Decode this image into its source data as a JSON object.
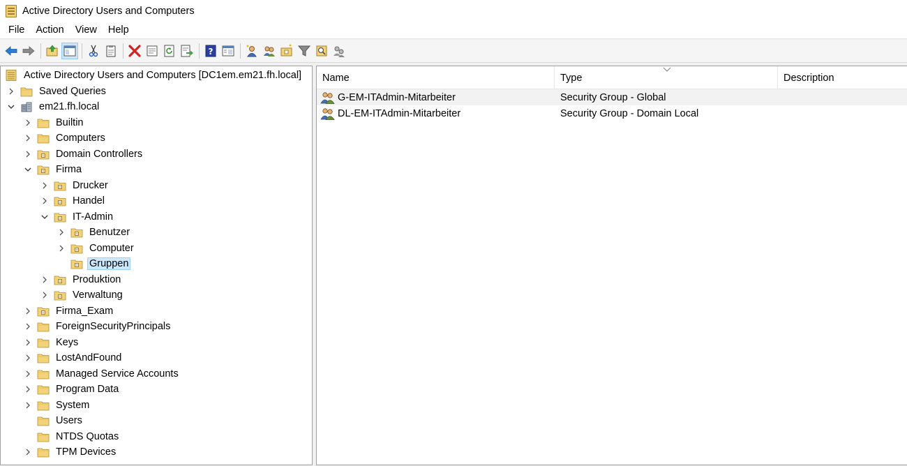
{
  "window": {
    "title": "Active Directory Users and Computers"
  },
  "menu": [
    "File",
    "Action",
    "View",
    "Help"
  ],
  "toolbar": {
    "buttons": [
      "back-icon",
      "forward-icon",
      "up-folder-icon",
      "show-hide-console-tree-icon",
      "cut-icon",
      "copy-icon",
      "delete-icon",
      "properties-icon",
      "refresh-icon",
      "export-list-icon",
      "help-icon",
      "mmc-view-icon",
      "new-user-icon",
      "new-group-icon",
      "new-ou-icon",
      "filter-icon",
      "find-icon",
      "add-to-group-icon"
    ]
  },
  "tree": [
    {
      "label": "Active Directory Users and Computers [DC1em.em21.fh.local]",
      "depth": 0,
      "chevron": "none",
      "icon": "root"
    },
    {
      "label": "Saved Queries",
      "depth": 1,
      "chevron": "right",
      "icon": "folder"
    },
    {
      "label": "em21.fh.local",
      "depth": 1,
      "chevron": "down",
      "icon": "domain"
    },
    {
      "label": "Builtin",
      "depth": 2,
      "chevron": "right",
      "icon": "folder"
    },
    {
      "label": "Computers",
      "depth": 2,
      "chevron": "right",
      "icon": "folder"
    },
    {
      "label": "Domain Controllers",
      "depth": 2,
      "chevron": "right",
      "icon": "ou"
    },
    {
      "label": "Firma",
      "depth": 2,
      "chevron": "down",
      "icon": "ou"
    },
    {
      "label": "Drucker",
      "depth": 3,
      "chevron": "right",
      "icon": "ou"
    },
    {
      "label": "Handel",
      "depth": 3,
      "chevron": "right",
      "icon": "ou"
    },
    {
      "label": "IT-Admin",
      "depth": 3,
      "chevron": "down",
      "icon": "ou"
    },
    {
      "label": "Benutzer",
      "depth": 4,
      "chevron": "right",
      "icon": "ou"
    },
    {
      "label": "Computer",
      "depth": 4,
      "chevron": "right",
      "icon": "ou"
    },
    {
      "label": "Gruppen",
      "depth": 4,
      "chevron": "none",
      "icon": "ou",
      "selected": true
    },
    {
      "label": "Produktion",
      "depth": 3,
      "chevron": "right",
      "icon": "ou"
    },
    {
      "label": "Verwaltung",
      "depth": 3,
      "chevron": "right",
      "icon": "ou"
    },
    {
      "label": "Firma_Exam",
      "depth": 2,
      "chevron": "right",
      "icon": "ou"
    },
    {
      "label": "ForeignSecurityPrincipals",
      "depth": 2,
      "chevron": "right",
      "icon": "folder"
    },
    {
      "label": "Keys",
      "depth": 2,
      "chevron": "right",
      "icon": "folder"
    },
    {
      "label": "LostAndFound",
      "depth": 2,
      "chevron": "right",
      "icon": "folder"
    },
    {
      "label": "Managed Service Accounts",
      "depth": 2,
      "chevron": "right",
      "icon": "folder"
    },
    {
      "label": "Program Data",
      "depth": 2,
      "chevron": "right",
      "icon": "folder"
    },
    {
      "label": "System",
      "depth": 2,
      "chevron": "right",
      "icon": "folder"
    },
    {
      "label": "Users",
      "depth": 2,
      "chevron": "none",
      "icon": "folder"
    },
    {
      "label": "NTDS Quotas",
      "depth": 2,
      "chevron": "none",
      "icon": "folder"
    },
    {
      "label": "TPM Devices",
      "depth": 2,
      "chevron": "right",
      "icon": "folder"
    }
  ],
  "list": {
    "columns": {
      "name": "Name",
      "type": "Type",
      "description": "Description"
    },
    "rows": [
      {
        "name": "G-EM-ITAdmin-Mitarbeiter",
        "type": "Security Group - Global",
        "description": ""
      },
      {
        "name": "DL-EM-ITAdmin-Mitarbeiter",
        "type": "Security Group - Domain Local",
        "description": ""
      }
    ]
  },
  "colors": {
    "selection": "#cce8ff",
    "selection_border": "#99d1ff",
    "folder": "#f3d37a"
  }
}
